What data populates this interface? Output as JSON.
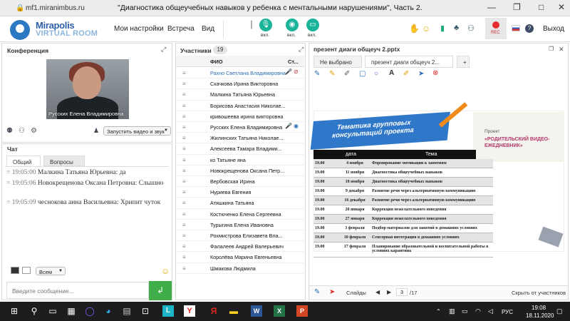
{
  "browser": {
    "url": "mf1.miranimbus.ru",
    "title": "\"Диагностика общеучебных навыков у ребенка с ментальными нарушениями\", Часть 2."
  },
  "toolbar": {
    "logo_line1": "Mirapolis",
    "logo_line2": "VIRTUAL ROOM",
    "menu": [
      "Мои настройки",
      "Встреча",
      "Вид"
    ],
    "mic_label": "вкл.",
    "cam_label": "вкл.",
    "screen_label": "вкл.",
    "rec_label": "REC",
    "exit": "Выход"
  },
  "conference": {
    "title": "Конференция",
    "video_caption": "Русских Елена Владимировна",
    "start_button": "Запустить видео и звук"
  },
  "chat": {
    "title": "Чат",
    "tabs": [
      "Общий",
      "Вопросы"
    ],
    "messages": [
      {
        "time": "19:05:00",
        "author": "Малкина Татьяна  Юрьевна:",
        "text": "да"
      },
      {
        "time": "19:05:06",
        "author": "Новокрещенова  Оксана Петровна:",
        "text": "Слышно"
      },
      {
        "time": "19:05:09",
        "author": "чеснокова  анна Васильевна:",
        "text": "Хрипит чуток"
      }
    ],
    "recipient": "Всем",
    "input_placeholder": "Введите сообщение..."
  },
  "participants": {
    "title": "Участники",
    "count": "19",
    "col_name": "ФИО",
    "col_status": "Ст...",
    "names": [
      "Рахно Светлана  Владимировна",
      "Скачкова  Ирина Викторовна",
      "Малкина Татьяна  Юрьевна",
      "Борисова  Анастасия Николае...",
      "кривошеева ирина викторовна",
      "Русских Елена Владимировна",
      "Жилинских  Татьяна  Николае...",
      "Алексеева  Тамара  Владими...",
      "ко Татьяне яна",
      "Новокрещенова  Оксана Петр...",
      "Вербовская Ирина",
      "Нуриева Евгения",
      "Атяшкина Татьяна",
      "Костюченко  Елена Сергеевна",
      "Турыгина  Елена  Ивановна",
      "Рохмистрова  Елизавета Вла...",
      "Фалалеев  Андрей  Валерьевич",
      "Королёва Марина Евгеньевна",
      "Шмакова Людмила"
    ]
  },
  "presentation": {
    "title": "презент диаги общеуч 2.pptx",
    "tabs": [
      "Не выбрано",
      "презент диаги общеуч 2...",
      "+"
    ],
    "slide": {
      "banner": "Тематика групповых консультаций проекта",
      "project_label": "Проект",
      "project_name": "«РОДИТЕЛЬСКИЙ ВИДЕО-ЕЖЕДНЕВНИК»",
      "col_date": "дата",
      "col_topic": "Тема",
      "rows": [
        {
          "time": "19.00",
          "date": "4 ноября",
          "topic": "Формирование мотивации к занятиям"
        },
        {
          "time": "19.00",
          "date": "11 ноября",
          "topic": "Диагностика общеучебных навыков"
        },
        {
          "time": "19.00",
          "date": "18 ноября",
          "topic": "Диагностика общеучебных навыков"
        },
        {
          "time": "19.00",
          "date": "9 декабря",
          "topic": "Развитие речи через альтернативную коммуникацию"
        },
        {
          "time": "19.00",
          "date": "16 декабря",
          "topic": "Развитие речи через альтернативную коммуникацию"
        },
        {
          "time": "19.00",
          "date": "20 января",
          "topic": "Коррекция нежелательного поведения"
        },
        {
          "time": "19.00",
          "date": "27 января",
          "topic": "Коррекция нежелательного поведения"
        },
        {
          "time": "19.00",
          "date": "3 февраля",
          "topic": "Подбор материалов для занятий в домашних условиях"
        },
        {
          "time": "19.00",
          "date": "10 февраля",
          "topic": "Сенсорная интеграция в домашних условиях"
        },
        {
          "time": "19.00",
          "date": "17 февраля",
          "topic": "Планирование образовательной и воспитательной работы в условиях карантина"
        }
      ]
    },
    "slides_label": "Слайды",
    "current_page": "3",
    "total_pages": "/17",
    "hide_participants": "Скрыть от участников"
  },
  "taskbar": {
    "language": "РУС",
    "time": "19:08",
    "date": "18.11.2020"
  },
  "colors": {
    "accent": "#19b49a",
    "link": "#2d6eb3",
    "send": "#3fae49"
  }
}
